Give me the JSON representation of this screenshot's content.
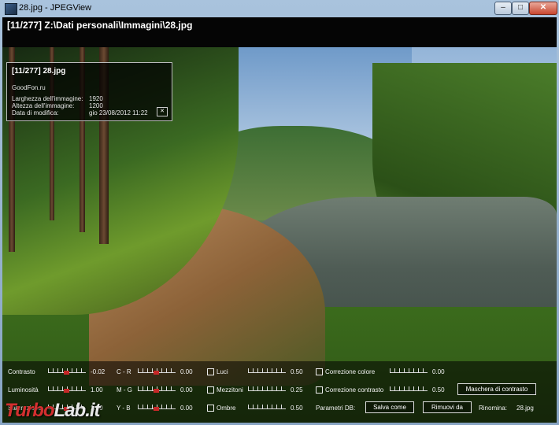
{
  "window": {
    "title": "28.jpg - JPEGView",
    "minimize_glyph": "–",
    "maximize_glyph": "□",
    "close_glyph": "✕"
  },
  "pathbar": {
    "text": "[11/277]  Z:\\Dati personali\\Immagini\\28.jpg"
  },
  "infobox": {
    "title": "[11/277]   28.jpg",
    "source": "GoodFon.ru",
    "rows": [
      {
        "label": "Larghezza dell'immagine:",
        "value": "1920"
      },
      {
        "label": "Altezza dell'immagine:",
        "value": "1200"
      },
      {
        "label": "Data di modifica:",
        "value": "gio 23/08/2012 11:22"
      }
    ],
    "close_glyph": "✕"
  },
  "panel": {
    "col1": [
      {
        "label": "Contrasto",
        "value": "-0.02"
      },
      {
        "label": "Luminosità",
        "value": "1.00"
      },
      {
        "label": "Saturazione",
        "value": "1.00"
      }
    ],
    "col2": [
      {
        "label": "C - R",
        "value": "0.00"
      },
      {
        "label": "M - G",
        "value": "0.00"
      },
      {
        "label": "Y - B",
        "value": "0.00"
      }
    ],
    "col3": [
      {
        "label": "Luci",
        "value": "0.50"
      },
      {
        "label": "Mezzitoni",
        "value": "0.25"
      },
      {
        "label": "Ombre",
        "value": "0.50"
      }
    ],
    "col4": [
      {
        "label": "Correzione colore",
        "value": "0.00"
      },
      {
        "label": "Correzione contrasto",
        "value": "0.50"
      }
    ],
    "params_label": "Parametri DB:",
    "save_button": "Salva come",
    "remove_button": "Rimuovi da",
    "rename_label": "Rinomina:",
    "rename_value": "28.jpg",
    "mask_button": "Maschera di contrasto"
  },
  "watermark": {
    "part1": "Turbo",
    "part2": "Lab.it"
  }
}
